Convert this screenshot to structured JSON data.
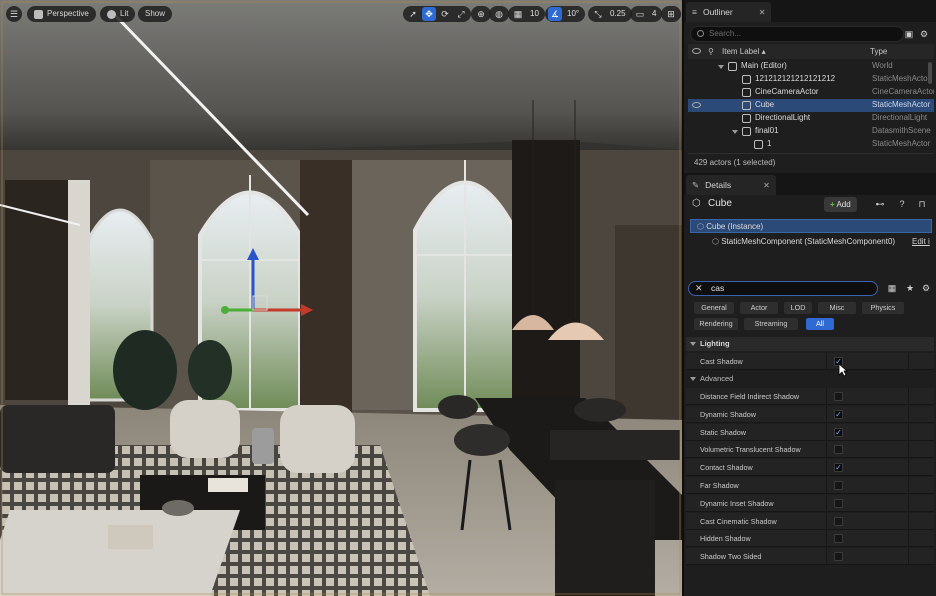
{
  "viewport": {
    "menu_icon": "hamburger-icon",
    "perspective_label": "Perspective",
    "lit_label": "Lit",
    "show_label": "Show",
    "grid_snap_value": "10",
    "rotation_snap_value": "10°",
    "scale_snap_value": "0.25",
    "camera_speed_value": "4"
  },
  "outliner": {
    "tab_label": "Outliner",
    "search_placeholder": "Search...",
    "col_label": "Item Label ▴",
    "col_type": "Type",
    "rows": [
      {
        "label": "Main (Editor)",
        "type": "World"
      },
      {
        "label": "121212121212121212",
        "type": "StaticMeshActor"
      },
      {
        "label": "CineCameraActor",
        "type": "CineCameraActor"
      },
      {
        "label": "Cube",
        "type": "StaticMeshActor"
      },
      {
        "label": "DirectionalLight",
        "type": "DirectionalLight"
      },
      {
        "label": "final01",
        "type": "DatasmithScene"
      },
      {
        "label": "1",
        "type": "StaticMeshActor"
      }
    ],
    "count_text": "429 actors (1 selected)"
  },
  "details": {
    "tab_label": "Details",
    "object_name": "Cube",
    "add_label": "Add",
    "instance_label": "Cube (Instance)",
    "component_label": "StaticMeshComponent (StaticMeshComponent0)",
    "edit_label": "Edit i",
    "filter_value": "cas",
    "chips_row1": [
      "General",
      "Actor",
      "LOD",
      "Misc",
      "Physics"
    ],
    "chips_row2": [
      "Rendering",
      "Streaming",
      "All"
    ],
    "section_lighting": "Lighting",
    "section_advanced": "Advanced",
    "cast_shadow_label": "Cast Shadow",
    "advanced_props": [
      {
        "label": "Distance Field Indirect Shadow",
        "checked": false
      },
      {
        "label": "Dynamic Shadow",
        "checked": true
      },
      {
        "label": "Static Shadow",
        "checked": true
      },
      {
        "label": "Volumetric Translucent Shadow",
        "checked": false
      },
      {
        "label": "Contact Shadow",
        "checked": true
      },
      {
        "label": "Far Shadow",
        "checked": false
      },
      {
        "label": "Dynamic Inset Shadow",
        "checked": false
      },
      {
        "label": "Cast Cinematic Shadow",
        "checked": false
      },
      {
        "label": "Hidden Shadow",
        "checked": false
      },
      {
        "label": "Shadow Two Sided",
        "checked": false
      }
    ]
  },
  "colors": {
    "accent": "#2f6ad3",
    "selection": "#2c4a78",
    "panel_bg": "#1e1e1e"
  }
}
